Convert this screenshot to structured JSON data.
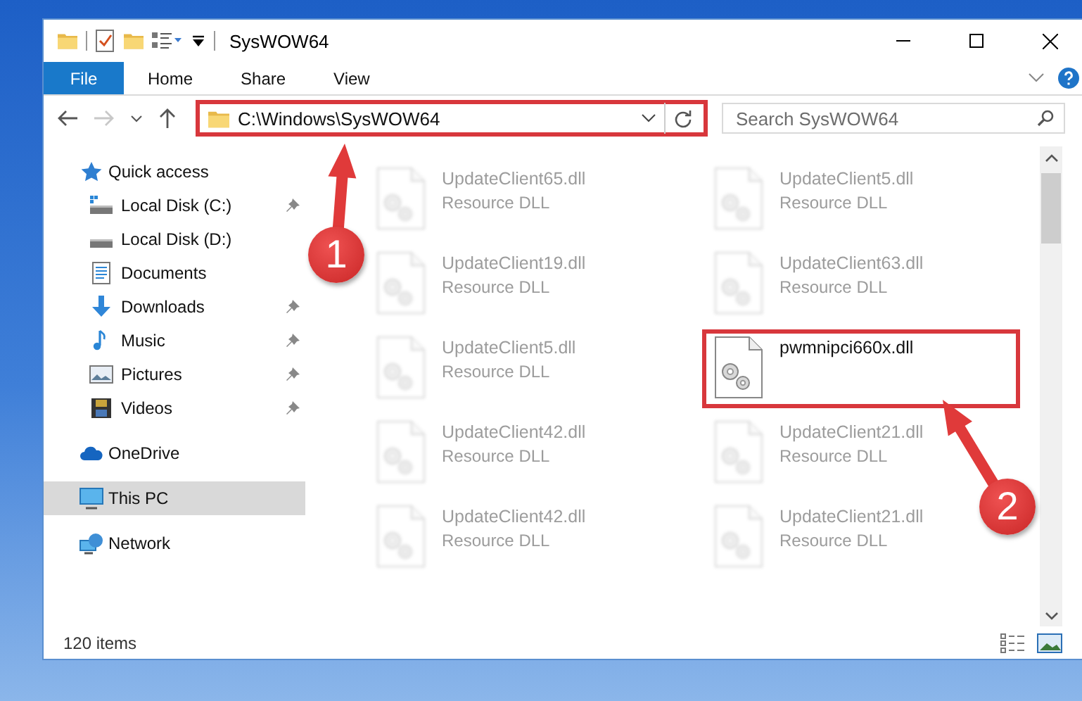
{
  "window": {
    "title": "SysWOW64"
  },
  "ribbon": {
    "tabs": [
      {
        "label": "File",
        "kind": "file"
      },
      {
        "label": "Home",
        "kind": "tab"
      },
      {
        "label": "Share",
        "kind": "tab"
      },
      {
        "label": "View",
        "kind": "tab"
      }
    ]
  },
  "address_bar": {
    "path": "C:\\Windows\\SysWOW64",
    "highlighted": true
  },
  "search": {
    "placeholder": "Search SysWOW64"
  },
  "navigation": {
    "items": [
      {
        "label": "Quick access",
        "kind": "star",
        "selected": false,
        "children": [
          {
            "label": "Local Disk (C:)",
            "kind": "sysdrive",
            "pinned": true,
            "selected": false
          },
          {
            "label": "Local Disk (D:)",
            "kind": "drive",
            "pinned": false,
            "selected": false
          },
          {
            "label": "Documents",
            "kind": "documents",
            "pinned": false,
            "selected": false
          },
          {
            "label": "Downloads",
            "kind": "downloads",
            "pinned": true,
            "selected": false
          },
          {
            "label": "Music",
            "kind": "music",
            "pinned": true,
            "selected": false
          },
          {
            "label": "Pictures",
            "kind": "pictures",
            "pinned": true,
            "selected": false
          },
          {
            "label": "Videos",
            "kind": "videos",
            "pinned": true,
            "selected": false
          }
        ]
      },
      {
        "label": "OneDrive",
        "kind": "cloud",
        "selected": false
      },
      {
        "label": "This PC",
        "kind": "computer",
        "selected": true
      },
      {
        "label": "Network",
        "kind": "network",
        "selected": false
      }
    ]
  },
  "files": [
    {
      "name": "UpdateClient65.dll",
      "type": "Resource DLL",
      "faded": true,
      "highlighted": false
    },
    {
      "name": "UpdateClient5.dll",
      "type": "Resource DLL",
      "faded": true,
      "highlighted": false
    },
    {
      "name": "UpdateClient19.dll",
      "type": "Resource DLL",
      "faded": true,
      "highlighted": false
    },
    {
      "name": "UpdateClient63.dll",
      "type": "Resource DLL",
      "faded": true,
      "highlighted": false
    },
    {
      "name": "UpdateClient5.dll",
      "type": "Resource DLL",
      "faded": true,
      "highlighted": false
    },
    {
      "name": "pwmnipci660x.dll",
      "faded": false,
      "highlighted": true
    },
    {
      "name": "UpdateClient42.dll",
      "type": "Resource DLL",
      "faded": true,
      "highlighted": false
    },
    {
      "name": "UpdateClient21.dll",
      "type": "Resource DLL",
      "faded": true,
      "highlighted": false
    },
    {
      "name": "UpdateClient42.dll",
      "type": "Resource DLL",
      "faded": true,
      "highlighted": false
    },
    {
      "name": "UpdateClient21.dll",
      "type": "Resource DLL",
      "faded": true,
      "highlighted": false
    }
  ],
  "status_bar": {
    "item_count": "120 items"
  },
  "annotations": [
    {
      "number": "1"
    },
    {
      "number": "2"
    }
  ]
}
